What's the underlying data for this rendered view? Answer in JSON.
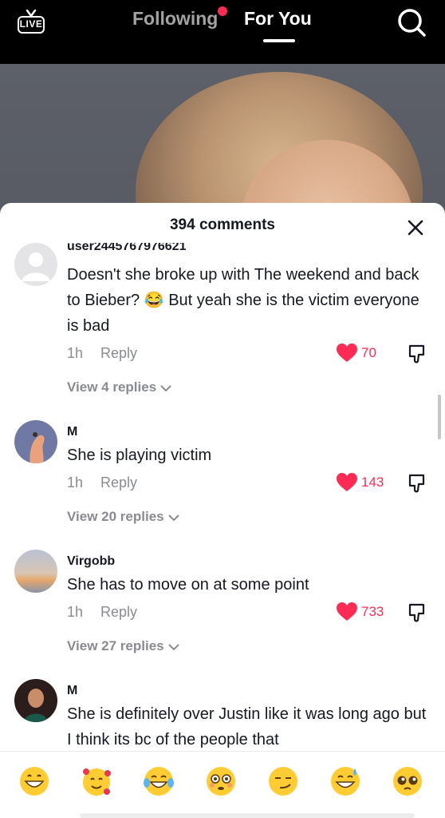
{
  "top": {
    "live_label": "LIVE",
    "tab_following": "Following",
    "tab_foryou": "For You",
    "icons": {
      "live": "live-tv-icon",
      "search": "search-icon"
    }
  },
  "comments_sheet": {
    "title": "394 comments",
    "close_icon": "close-icon",
    "items": [
      {
        "username": "user2445767976621",
        "text": "Doesn't she broke up with The weekend and back to Bieber? 😂 But yeah she is the victim everyone is bad",
        "time": "1h",
        "reply": "Reply",
        "likes": "70",
        "view_replies": "View 4 replies"
      },
      {
        "username": "M",
        "text": "She is playing victim",
        "time": "1h",
        "reply": "Reply",
        "likes": "143",
        "view_replies": "View 20 replies"
      },
      {
        "username": "Virgobb",
        "text": "She has to move on at some point",
        "time": "1h",
        "reply": "Reply",
        "likes": "733",
        "view_replies": "View 27 replies"
      },
      {
        "username": "M",
        "text": "She is definitely over Justin like it was long ago but I think its bc of the people that"
      }
    ],
    "emojis": [
      "😁",
      "🥰",
      "😂",
      "😳",
      "😏",
      "😅",
      "🥺"
    ]
  },
  "colors": {
    "accent": "#fe2c55",
    "secondary_text": "#8a8b91",
    "primary_text": "#161823"
  }
}
